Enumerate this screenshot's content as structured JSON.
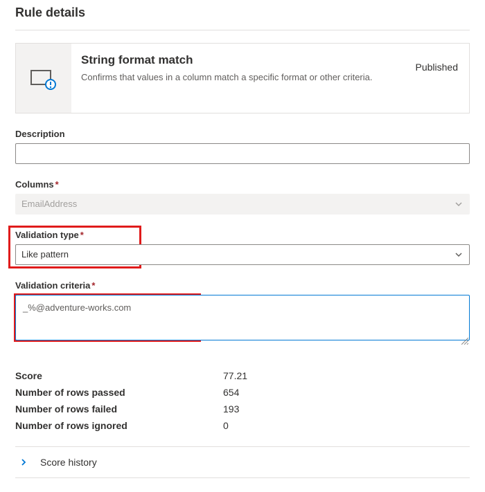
{
  "pageTitle": "Rule details",
  "card": {
    "title": "String format match",
    "description": "Confirms that values in a column match a specific format or other criteria.",
    "status": "Published"
  },
  "fields": {
    "descriptionLabel": "Description",
    "descriptionValue": "",
    "columnsLabel": "Columns",
    "columnsValue": "EmailAddress",
    "validationTypeLabel": "Validation type",
    "validationTypeValue": "Like pattern",
    "validationCriteriaLabel": "Validation criteria",
    "validationCriteriaValue": "_%@adventure-works.com"
  },
  "stats": {
    "scoreLabel": "Score",
    "scoreValue": "77.21",
    "passedLabel": "Number of rows passed",
    "passedValue": "654",
    "failedLabel": "Number of rows failed",
    "failedValue": "193",
    "ignoredLabel": "Number of rows ignored",
    "ignoredValue": "0"
  },
  "history": {
    "label": "Score history"
  }
}
